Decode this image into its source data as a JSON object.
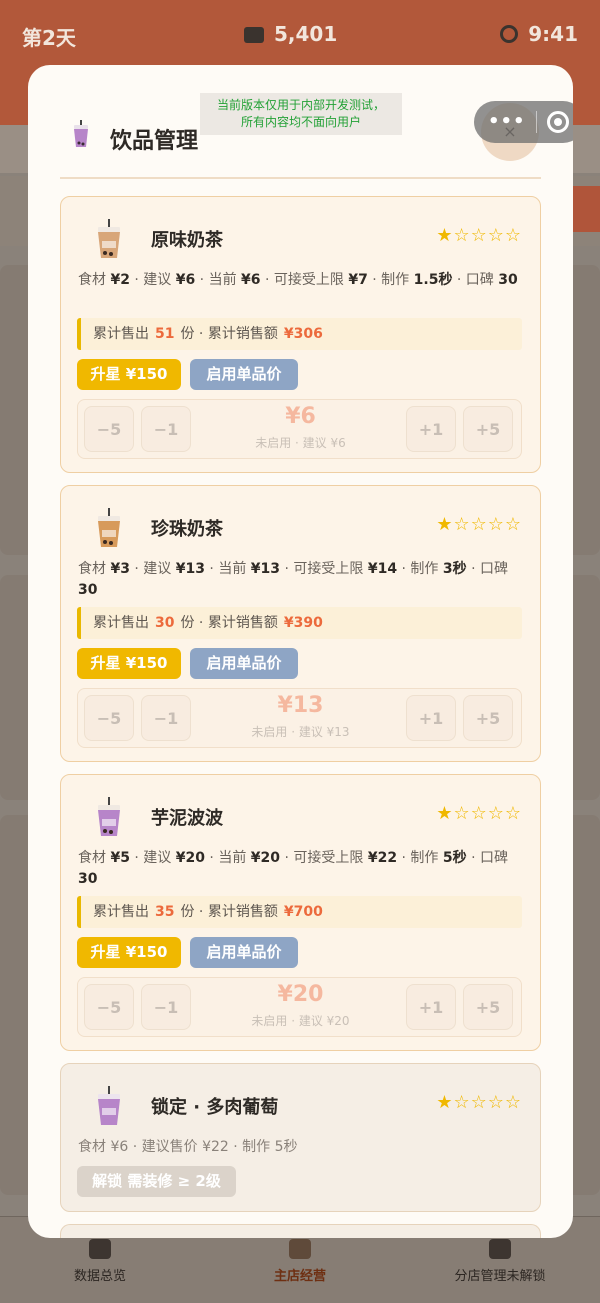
{
  "status": {
    "day": "第2天",
    "money": "5,401",
    "time": "9:41"
  },
  "notice": {
    "line1": "当前版本仅用于内部开发测试，",
    "line2": "所有内容均不面向用户"
  },
  "modal": {
    "title": "饮品管理",
    "close": "×"
  },
  "labels": {
    "sales_prefix": "累计售出",
    "sales_unit": "份 · 累计销售额",
    "minus5": "−5",
    "minus1": "−1",
    "plus1": "+1",
    "plus5": "+5"
  },
  "drinks": [
    {
      "name": "原味奶茶",
      "stars": "★☆☆☆☆",
      "info_a": "食材 ",
      "cost": "¥2",
      "info_b": " · 建议 ",
      "suggest": "¥6",
      "info_c": " · 当前 ",
      "current": "¥6",
      "info_d": " · 可接受上限 ",
      "limit": "¥7",
      "info_e": " · 制作 ",
      "make": "1.5秒",
      "info_f": " · 口碑 ",
      "rep": "30",
      "sold": "51",
      "revenue": "¥306",
      "upgrade": "升星 ¥150",
      "enable_price": "启用单品价",
      "price": "¥6",
      "price_sub": "未启用 · 建议 ¥6",
      "cup_color": "#d8a679"
    },
    {
      "name": "珍珠奶茶",
      "stars": "★☆☆☆☆",
      "info_a": "食材 ",
      "cost": "¥3",
      "info_b": " · 建议 ",
      "suggest": "¥13",
      "info_c": " · 当前 ",
      "current": "¥13",
      "info_d": " · 可接受上限 ",
      "limit": "¥14",
      "info_e": " · 制作 ",
      "make": "3秒",
      "info_f": " · 口碑 ",
      "rep": "30",
      "sold": "30",
      "revenue": "¥390",
      "upgrade": "升星 ¥150",
      "enable_price": "启用单品价",
      "price": "¥13",
      "price_sub": "未启用 · 建议 ¥13",
      "cup_color": "#d79a5b"
    },
    {
      "name": "芋泥波波",
      "stars": "★☆☆☆☆",
      "info_a": "食材 ",
      "cost": "¥5",
      "info_b": " · 建议 ",
      "suggest": "¥20",
      "info_c": " · 当前 ",
      "current": "¥20",
      "info_d": " · 可接受上限 ",
      "limit": "¥22",
      "info_e": " · 制作 ",
      "make": "5秒",
      "info_f": " · 口碑 ",
      "rep": "30",
      "sold": "35",
      "revenue": "¥700",
      "upgrade": "升星 ¥150",
      "enable_price": "启用单品价",
      "price": "¥20",
      "price_sub": "未启用 · 建议 ¥20",
      "cup_color": "#b785c9"
    }
  ],
  "locked": {
    "name": "锁定 · 多肉葡萄",
    "stars": "★☆☆☆☆",
    "info": "食材 ¥6 · 建议售价 ¥22 · 制作 5秒",
    "unlock": "解锁 需装修 ≥ 2级",
    "cup_color": "#b785c9"
  },
  "tabs": {
    "overview": "数据总览",
    "main_store": "主店经营",
    "branch": "分店管理未解锁"
  },
  "colors": {
    "accent": "#f0b800",
    "price_btn": "#8ea5c5",
    "sales_num": "#ec6a3c",
    "notice": "#23a136"
  }
}
